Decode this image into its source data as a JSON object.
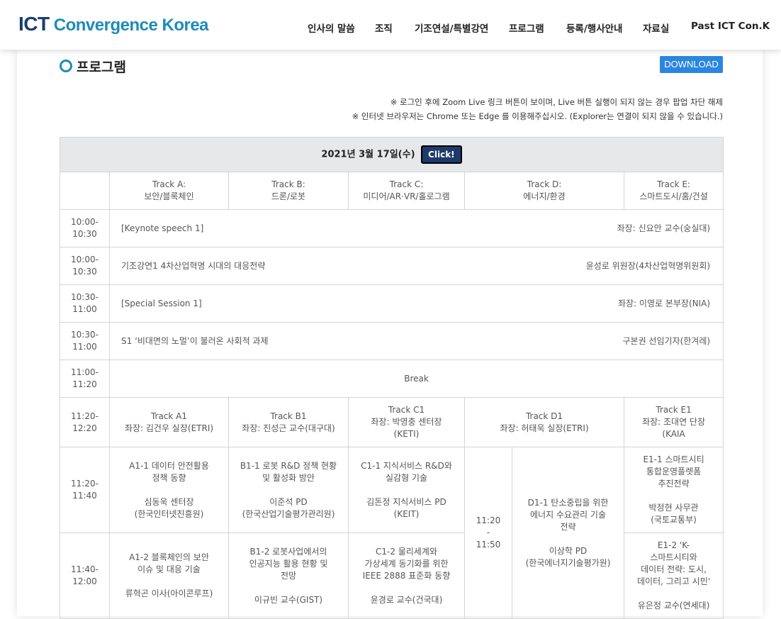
{
  "header": {
    "logo_ict": "ICT",
    "logo_rest": "Convergence Korea",
    "nav": [
      "인사의 말씀",
      "조직",
      "기조연설/특별강연",
      "프로그램",
      "등록/행사안내",
      "자료실",
      "Past ICT Con.K"
    ]
  },
  "page": {
    "title": "프로그램",
    "download_label": "DOWNLOAD",
    "notice1": "※ 로그인 후에 Zoom Live 링크 버튼이 보이며, Live 버튼 실행이 되지 않는 경우 팝업 차단 해제",
    "notice2": "※ 인터넷 브라우저는 Chrome 또는 Edge 를 이용해주십시오. (Explorer는 연결이 되지 않을 수 있습니다.)"
  },
  "table": {
    "date": "2021년 3월 17일(수)",
    "click_label": "Click!",
    "tracks": [
      {
        "name": "Track A:",
        "topic": "보안/블록체인"
      },
      {
        "name": "Track B:",
        "topic": "드론/로봇"
      },
      {
        "name": "Track C:",
        "topic": "미디어/AR·VR/홀로그램"
      },
      {
        "name": "Track D:",
        "topic": "에너지/환경"
      },
      {
        "name": "Track E:",
        "topic": "스마트도시/홈/건설"
      }
    ],
    "wide_rows": [
      {
        "time1": "10:00-",
        "time2": "10:30",
        "left": "[Keynote speech 1]",
        "right": "좌장: 신요안 교수(숭실대)"
      },
      {
        "time1": "10:00-",
        "time2": "10:30",
        "left": "기조강연1 4차산업혁명 시대의 대응전략",
        "right": "윤성로 위원장(4차산업혁명위원회)"
      },
      {
        "time1": "10:30-",
        "time2": "11:00",
        "left": "[Special Session 1]",
        "right": "좌장: 이영로 본부장(NIA)"
      },
      {
        "time1": "10:30-",
        "time2": "11:00",
        "left": "S1 ‘비대면의 노멀’이 불러온 사회적 과제",
        "right": "구본권 선임기자(한겨레)"
      }
    ],
    "break_row": {
      "time1": "11:00-",
      "time2": "11:20",
      "label": "Break"
    },
    "chair_row": {
      "time1": "11:20-",
      "time2": "12:20",
      "cells": [
        {
          "track": "Track A1",
          "chair": "좌장: 김건우 실장(ETRI)"
        },
        {
          "track": "Track B1",
          "chair": "좌장: 진성근 교수(대구대)"
        },
        {
          "track": "Track C1",
          "chair": "좌장: 박영충 센터장",
          "chair2": "(KETI)"
        },
        {
          "track": "Track D1",
          "chair": "좌장: 허태욱 실장(ETRI)"
        },
        {
          "track": "Track E1",
          "chair": "좌장: 조대연 단장",
          "chair2": "(KAIA"
        }
      ]
    },
    "session1": {
      "time1": "11:20-",
      "time2": "11:40",
      "a": {
        "l1": "A1-1 데이터 안전활용",
        "l2": "정책 동향",
        "s1": "심동욱 센터장",
        "s2": "(한국인터넷진흥원)"
      },
      "b": {
        "l1": "B1-1 로봇 R&D 정책 현황",
        "l2": "및 활성화 방안",
        "s1": "이준석 PD",
        "s2": "(한국산업기술평가관리원)"
      },
      "c": {
        "l1": "C1-1 지식서비스 R&D와",
        "l2": "실감형 기술",
        "s1": "김돈정 지식서비스 PD",
        "s2": "(KEIT)"
      },
      "d_time1": "11:20",
      "d_time2": "-",
      "d_time3": "11:50",
      "d": {
        "l1": "D1-1 탄소중립을 위한",
        "l2": "에너지 수요관리 기술",
        "l3": "전략",
        "s1": "이상학 PD",
        "s2": "(한국에너지기술평가원)"
      },
      "e": {
        "l1": "E1-1 스마트시티",
        "l2": "통합운영플렛폼",
        "l3": "추진전략",
        "s1": "박정현 사무관",
        "s2": "(국토교통부)"
      }
    },
    "session2": {
      "time1": "11:40-",
      "time2": "12:00",
      "a": {
        "l1": "A1-2 블록체인의 보안",
        "l2": "이슈 및 대응 기술",
        "s1": "류혁곤 이사(아이콘루프)"
      },
      "b": {
        "l1": "B1-2 로봇사업에서의",
        "l2": "인공지능 활용 현황 및",
        "l3": "전망",
        "s1": "이규빈 교수(GIST)"
      },
      "c": {
        "l1": "C1-2 물리세계와",
        "l2": "가상세계 동기화를 위한",
        "l3": "IEEE 2888 표준화 동향",
        "s1": "윤경로 교수(건국대)"
      },
      "e": {
        "l1": "E1-2 'K-",
        "l2": "스마트시티와",
        "l3": "데이터 전략: 도시,",
        "l4": "데이터, 그리고 시민'",
        "s1": "유은정 교수(연세대)"
      }
    }
  }
}
